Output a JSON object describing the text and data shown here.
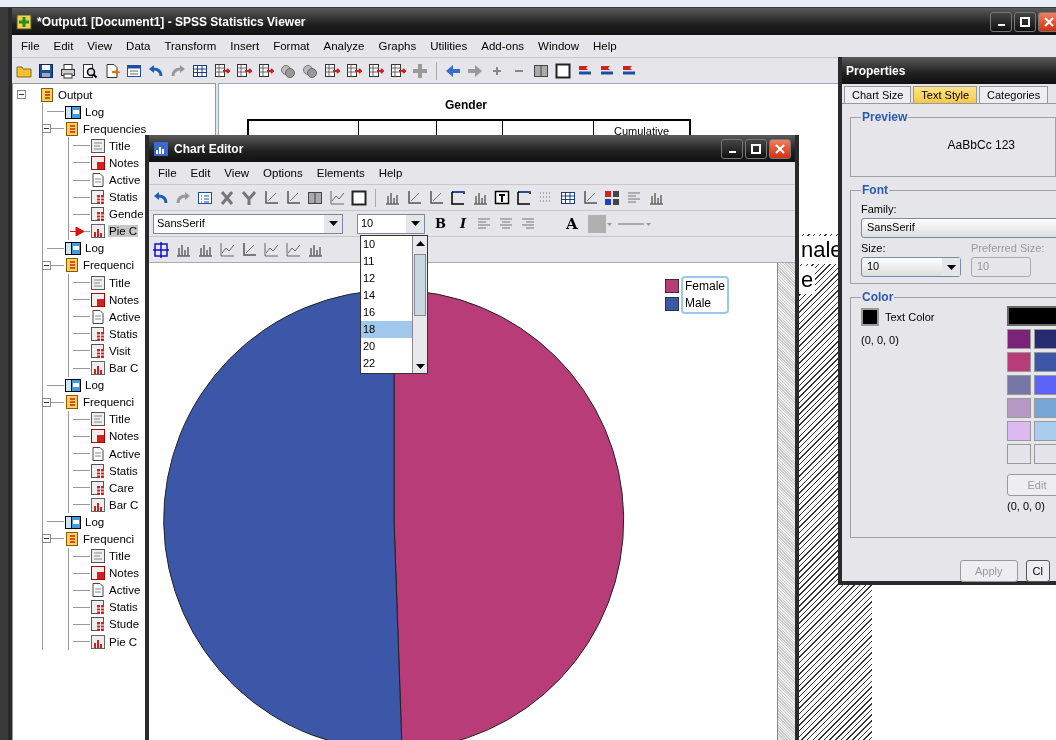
{
  "viewer": {
    "title": "*Output1 [Document1] - SPSS Statistics Viewer",
    "menu": [
      "File",
      "Edit",
      "View",
      "Data",
      "Transform",
      "Insert",
      "Format",
      "Analyze",
      "Graphs",
      "Utilities",
      "Add-ons",
      "Window",
      "Help"
    ],
    "outline": [
      {
        "label": "Output",
        "kind": "folder",
        "selected": false,
        "expanded": true,
        "children": [
          {
            "label": "Log",
            "kind": "log",
            "selected": false
          },
          {
            "label": "Frequencies",
            "kind": "folder",
            "selected": false,
            "expanded": true,
            "children": [
              {
                "label": "Title",
                "kind": "title",
                "selected": false
              },
              {
                "label": "Notes",
                "kind": "notes",
                "selected": false
              },
              {
                "label": "Active",
                "kind": "text",
                "selected": false
              },
              {
                "label": "Statis",
                "kind": "table",
                "selected": false
              },
              {
                "label": "Gende",
                "kind": "table",
                "selected": false
              },
              {
                "label": "Pie C",
                "kind": "chart",
                "selected": true
              }
            ]
          },
          {
            "label": "Log",
            "kind": "log",
            "selected": false
          },
          {
            "label": "Frequenci",
            "kind": "folder",
            "selected": false,
            "expanded": true,
            "children": [
              {
                "label": "Title",
                "kind": "title",
                "selected": false
              },
              {
                "label": "Notes",
                "kind": "notes",
                "selected": false
              },
              {
                "label": "Active",
                "kind": "text",
                "selected": false
              },
              {
                "label": "Statis",
                "kind": "table",
                "selected": false
              },
              {
                "label": "Visit",
                "kind": "table",
                "selected": false
              },
              {
                "label": "Bar C",
                "kind": "chart",
                "selected": false
              }
            ]
          },
          {
            "label": "Log",
            "kind": "log",
            "selected": false
          },
          {
            "label": "Frequenci",
            "kind": "folder",
            "selected": false,
            "expanded": true,
            "children": [
              {
                "label": "Title",
                "kind": "title",
                "selected": false
              },
              {
                "label": "Notes",
                "kind": "notes",
                "selected": false
              },
              {
                "label": "Active",
                "kind": "text",
                "selected": false
              },
              {
                "label": "Statis",
                "kind": "table",
                "selected": false
              },
              {
                "label": "Care",
                "kind": "table",
                "selected": false
              },
              {
                "label": "Bar C",
                "kind": "chart",
                "selected": false
              }
            ]
          },
          {
            "label": "Log",
            "kind": "log",
            "selected": false
          },
          {
            "label": "Frequenci",
            "kind": "folder",
            "selected": false,
            "expanded": true,
            "children": [
              {
                "label": "Title",
                "kind": "title",
                "selected": false
              },
              {
                "label": "Notes",
                "kind": "notes",
                "selected": false
              },
              {
                "label": "Active",
                "kind": "text",
                "selected": false
              },
              {
                "label": "Statis",
                "kind": "table",
                "selected": false
              },
              {
                "label": "Stude",
                "kind": "table",
                "selected": false
              },
              {
                "label": "Pie C",
                "kind": "chart",
                "selected": false
              }
            ]
          }
        ]
      }
    ],
    "table_title": "Gender",
    "table_header": "Cumulative",
    "chart_fragments": [
      "nale",
      "e"
    ]
  },
  "chart_editor": {
    "title": "Chart Editor",
    "menu": [
      "File",
      "Edit",
      "View",
      "Options",
      "Elements",
      "Help"
    ],
    "font_family": "SansSerif",
    "font_size": "10",
    "size_options": [
      {
        "label": "10",
        "selected": false
      },
      {
        "label": "11",
        "selected": false
      },
      {
        "label": "12",
        "selected": false
      },
      {
        "label": "14",
        "selected": false
      },
      {
        "label": "16",
        "selected": false
      },
      {
        "label": "18",
        "selected": true
      },
      {
        "label": "20",
        "selected": false
      },
      {
        "label": "22",
        "selected": false
      }
    ],
    "bold_button": "B",
    "italic_button": "I",
    "text_color_button": "A",
    "legend": {
      "selected": true,
      "items": [
        {
          "label": "Female",
          "color": "#b83c78"
        },
        {
          "label": "Male",
          "color": "#3d57a8"
        }
      ]
    }
  },
  "properties": {
    "title": "Properties",
    "tabs": [
      {
        "label": "Chart Size",
        "selected": false
      },
      {
        "label": "Text Style",
        "selected": true
      },
      {
        "label": "Categories",
        "selected": false
      }
    ],
    "preview_label": "Preview",
    "preview_text": "AaBbCc 123",
    "font_label": "Font",
    "family_label": "Family:",
    "family": "SansSerif",
    "size_label": "Size:",
    "size": "10",
    "preferred_size_label": "Preferred Size:",
    "preferred_size": "10",
    "color_label": "Color",
    "text_color_label": "Text Color",
    "text_color_swatch": {
      "color": "#000000"
    },
    "text_color_rgb": "(0, 0, 0)",
    "swatches": [
      {
        "color": "#000000",
        "selected": true
      },
      {
        "color": "#7a2479",
        "selected": false
      },
      {
        "color": "#262a6e",
        "selected": false
      },
      {
        "color": "#b83c78",
        "selected": false
      },
      {
        "color": "#3d57a8",
        "selected": false
      },
      {
        "color": "#7677a6",
        "selected": false
      },
      {
        "color": "#5c63f6",
        "selected": false
      },
      {
        "color": "#b697c6",
        "selected": false
      },
      {
        "color": "#78a6d6",
        "selected": false
      },
      {
        "color": "#dcb9ef",
        "selected": false
      },
      {
        "color": "#a8cdee",
        "selected": false
      },
      {
        "color": "#e4e4ea",
        "selected": false
      },
      {
        "color": "#e4e4ea",
        "selected": false
      }
    ],
    "edit_button": "Edit",
    "swatch_rgb": "(0, 0, 0)",
    "apply_button": "Apply",
    "close_button": "Cl"
  }
}
